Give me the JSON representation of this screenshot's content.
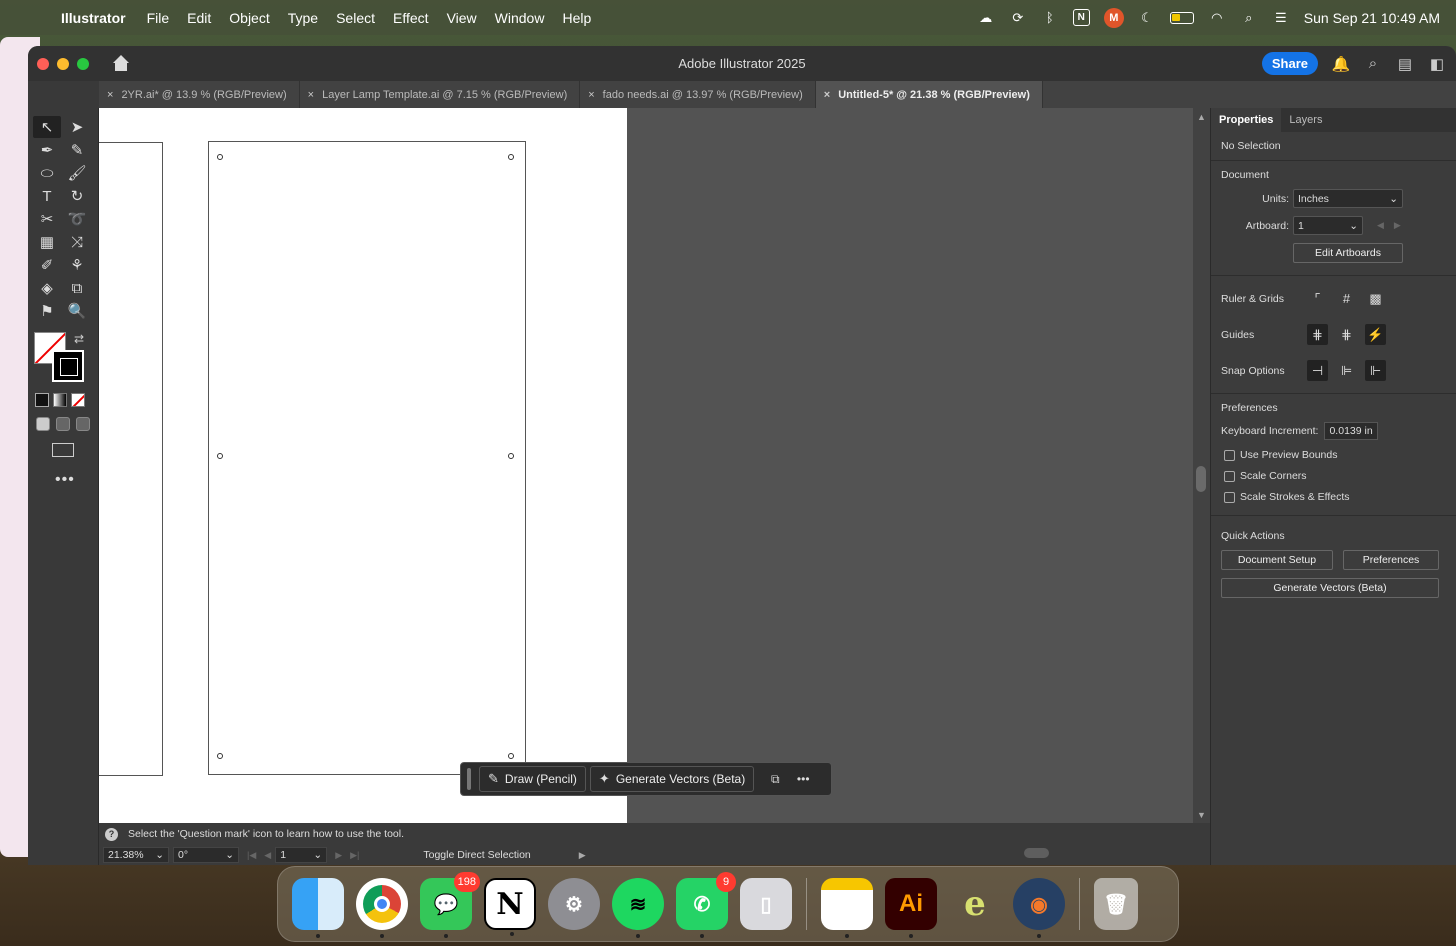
{
  "menubar": {
    "app_name": "Illustrator",
    "menus": [
      "File",
      "Edit",
      "Object",
      "Type",
      "Select",
      "Effect",
      "View",
      "Window",
      "Help"
    ],
    "status_icons": [
      "creative-cloud-icon",
      "sync-icon",
      "bluetooth-icon",
      "notion-icon",
      "tray-app-icon",
      "moon-icon",
      "battery-icon",
      "wifi-icon",
      "search-icon",
      "control-center-icon"
    ],
    "notion_glyph": "N",
    "tray_glyph": "M",
    "clock": "Sun Sep 21  10:49 AM"
  },
  "window": {
    "title": "Adobe Illustrator 2025",
    "share_label": "Share"
  },
  "tabs": [
    {
      "label": "2YR.ai* @ 13.9 % (RGB/Preview)",
      "active": false
    },
    {
      "label": "Layer Lamp Template.ai @ 7.15 % (RGB/Preview)",
      "active": false
    },
    {
      "label": "fado needs.ai @ 13.97 % (RGB/Preview)",
      "active": false
    },
    {
      "label": "Untitled-5* @ 21.38 % (RGB/Preview)",
      "active": true
    }
  ],
  "tab_close_glyph": "×",
  "tools": [
    {
      "name": "selection-tool-icon",
      "glyph": "↖"
    },
    {
      "name": "direct-selection-tool-icon",
      "glyph": "➤"
    },
    {
      "name": "pen-tool-icon",
      "glyph": "✒"
    },
    {
      "name": "curvature-tool-icon",
      "glyph": "✎"
    },
    {
      "name": "ellipse-tool-icon",
      "glyph": "⬭"
    },
    {
      "name": "paintbrush-tool-icon",
      "glyph": "🖌"
    },
    {
      "name": "type-tool-icon",
      "glyph": "T"
    },
    {
      "name": "rotate-tool-icon",
      "glyph": "↻"
    },
    {
      "name": "scissors-tool-icon",
      "glyph": "✂"
    },
    {
      "name": "lasso-tool-icon",
      "glyph": "➰"
    },
    {
      "name": "gradient-tool-icon",
      "glyph": "▦"
    },
    {
      "name": "width-tool-icon",
      "glyph": "⤨"
    },
    {
      "name": "eyedropper-tool-icon",
      "glyph": "✐"
    },
    {
      "name": "blend-tool-icon",
      "glyph": "⚘"
    },
    {
      "name": "shape-builder-tool-icon",
      "glyph": "◈"
    },
    {
      "name": "artboard-tool-icon",
      "glyph": "⧉"
    },
    {
      "name": "perspective-tool-icon",
      "glyph": "⚑"
    },
    {
      "name": "zoom-tool-icon",
      "glyph": "🔍"
    }
  ],
  "swap_glyph": "⇄",
  "more_tools_glyph": "•••",
  "hint": {
    "q_glyph": "?",
    "text": "Select the 'Question mark' icon to learn how to use the tool."
  },
  "status": {
    "zoom": "21.38%",
    "rotation": "0°",
    "artboard": "1",
    "toggle_label": "Toggle Direct Selection"
  },
  "taskbar": {
    "draw_label": "Draw (Pencil)",
    "generate_label": "Generate Vectors (Beta)",
    "more_glyph": "•••"
  },
  "properties": {
    "tabs": [
      "Properties",
      "Layers"
    ],
    "selection": "No Selection",
    "document_heading": "Document",
    "units_label": "Units:",
    "units_value": "Inches",
    "artboard_label": "Artboard:",
    "artboard_value": "1",
    "edit_artboards": "Edit Artboards",
    "ruler_grids": "Ruler & Grids",
    "guides": "Guides",
    "snap_options": "Snap Options",
    "preferences_heading": "Preferences",
    "keyboard_increment_label": "Keyboard Increment:",
    "keyboard_increment_value": "0.0139 in",
    "checkboxes": [
      "Use Preview Bounds",
      "Scale Corners",
      "Scale Strokes & Effects"
    ],
    "quick_actions_heading": "Quick Actions",
    "document_setup": "Document Setup",
    "preferences_button": "Preferences",
    "generate_vectors": "Generate Vectors (Beta)"
  },
  "dock": {
    "messages_badge": "198",
    "whatsapp_badge": "9",
    "notion_glyph": "N",
    "ai_glyph": "Ai",
    "e_glyph": "e"
  }
}
